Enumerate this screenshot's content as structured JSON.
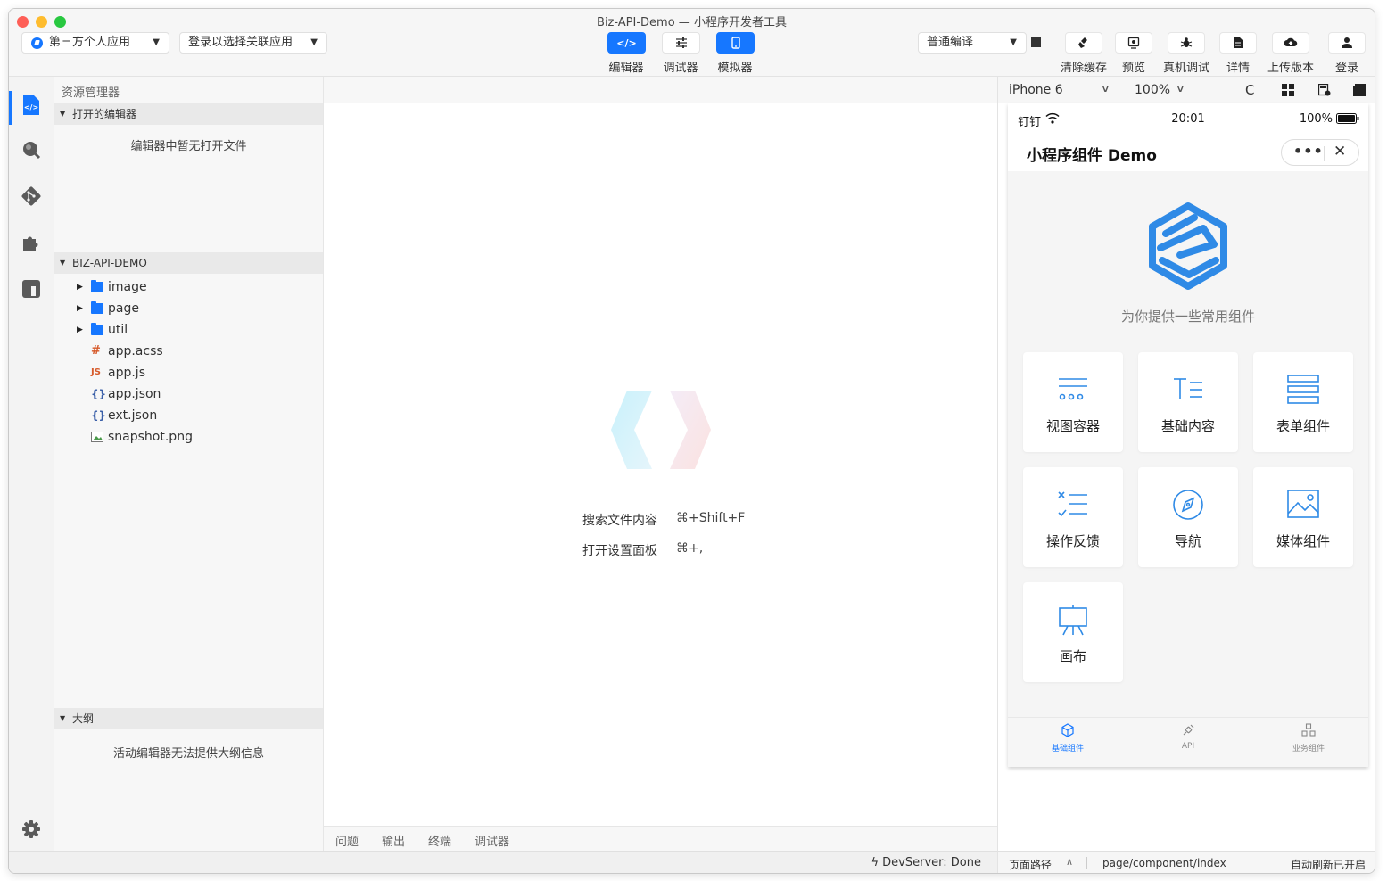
{
  "window": {
    "title": "Biz-API-Demo — 小程序开发者工具"
  },
  "toolbar": {
    "app_select": "第三方个人应用",
    "link_select": "登录以选择关联应用",
    "modes": [
      {
        "label": "编辑器",
        "icon": "code-icon",
        "active": true
      },
      {
        "label": "调试器",
        "icon": "sliders-icon",
        "active": false
      },
      {
        "label": "模拟器",
        "icon": "phone-icon",
        "active": true
      }
    ],
    "compile_select": "普通编译",
    "tools": [
      {
        "label": "清除缓存",
        "icon": "broom-icon"
      },
      {
        "label": "预览",
        "icon": "preview-icon"
      },
      {
        "label": "真机调试",
        "icon": "bug-icon"
      },
      {
        "label": "详情",
        "icon": "document-icon"
      },
      {
        "label": "上传版本",
        "icon": "cloud-upload-icon"
      },
      {
        "label": "登录",
        "icon": "user-icon"
      }
    ]
  },
  "explorer": {
    "title": "资源管理器",
    "open_editors": {
      "header": "打开的编辑器",
      "empty": "编辑器中暂无打开文件"
    },
    "project": {
      "header": "BIZ-API-DEMO",
      "items": [
        {
          "name": "image",
          "type": "folder"
        },
        {
          "name": "page",
          "type": "folder"
        },
        {
          "name": "util",
          "type": "folder"
        },
        {
          "name": "app.acss",
          "type": "css",
          "glyph": "#"
        },
        {
          "name": "app.js",
          "type": "js",
          "glyph": "JS"
        },
        {
          "name": "app.json",
          "type": "json",
          "glyph": "{}"
        },
        {
          "name": "ext.json",
          "type": "json",
          "glyph": "{}"
        },
        {
          "name": "snapshot.png",
          "type": "image"
        }
      ]
    },
    "outline": {
      "header": "大纲",
      "empty": "活动编辑器无法提供大纲信息"
    }
  },
  "editor": {
    "shortcuts": [
      {
        "label": "搜索文件内容",
        "key": "⌘+Shift+F"
      },
      {
        "label": "打开设置面板",
        "key": "⌘+,"
      }
    ],
    "panel_tabs": [
      "问题",
      "输出",
      "终端",
      "调试器"
    ]
  },
  "simulator": {
    "device": "iPhone 6",
    "zoom": "100%",
    "statusbar": {
      "carrier": "钉钉",
      "time": "20:01",
      "battery": "100%"
    },
    "nav_title": "小程序组件 Demo",
    "hero_text": "为你提供一些常用组件",
    "cards": [
      {
        "label": "视图容器",
        "icon": "view-container-icon"
      },
      {
        "label": "基础内容",
        "icon": "text-icon"
      },
      {
        "label": "表单组件",
        "icon": "form-icon"
      },
      {
        "label": "操作反馈",
        "icon": "feedback-icon"
      },
      {
        "label": "导航",
        "icon": "compass-icon"
      },
      {
        "label": "媒体组件",
        "icon": "image-icon"
      },
      {
        "label": "画布",
        "icon": "canvas-icon"
      }
    ],
    "tabbar": [
      {
        "label": "基础组件",
        "active": true
      },
      {
        "label": "API",
        "active": false
      },
      {
        "label": "业务组件",
        "active": false
      }
    ]
  },
  "status": {
    "devserver": "DevServer: Done",
    "page_path_label": "页面路径",
    "page_path": "page/component/index",
    "auto_refresh": "自动刷新已开启"
  },
  "colors": {
    "accent": "#1677ff",
    "hero_blue": "#2f8ae6"
  }
}
